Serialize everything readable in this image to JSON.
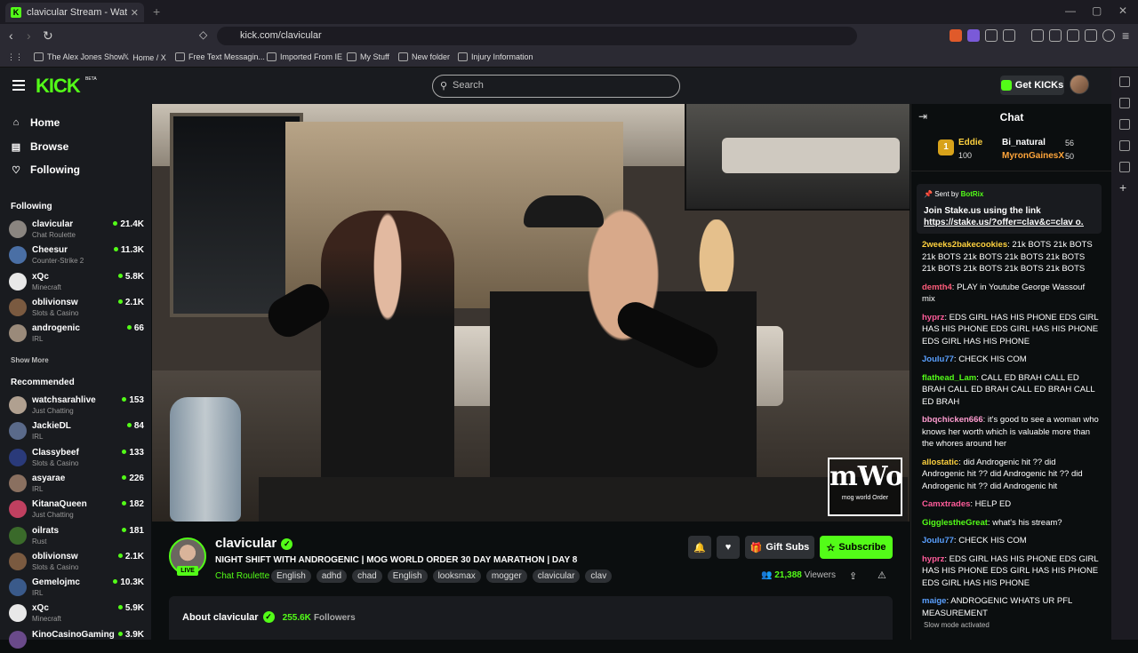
{
  "browser": {
    "tab_title": "clavicular Stream - Watch Live",
    "url": "kick.com/clavicular",
    "bookmarks": [
      "The Alex Jones Show",
      "Home / X",
      "Free Text Messagin...",
      "Imported From IE",
      "My Stuff",
      "New folder",
      "Injury Information"
    ]
  },
  "header": {
    "logo": "KICK",
    "beta": "BETA",
    "search_placeholder": "Search",
    "get_kicks": "Get KICKs"
  },
  "nav": [
    {
      "label": "Home",
      "icon": "home-icon"
    },
    {
      "label": "Browse",
      "icon": "browse-icon"
    },
    {
      "label": "Following",
      "icon": "heart-icon"
    }
  ],
  "following_title": "Following",
  "following": [
    {
      "name": "clavicular",
      "category": "Chat Roulette",
      "viewers": "21.4K",
      "color": "#8a8580"
    },
    {
      "name": "Cheesur",
      "category": "Counter-Strike 2",
      "viewers": "11.3K",
      "color": "#4a6fa5"
    },
    {
      "name": "xQc",
      "category": "Minecraft",
      "viewers": "5.8K",
      "color": "#e8e8e8"
    },
    {
      "name": "oblivionsw",
      "category": "Slots & Casino",
      "viewers": "2.1K",
      "color": "#7a5a40"
    },
    {
      "name": "androgenic",
      "category": "IRL",
      "viewers": "66",
      "color": "#9a8a7a"
    }
  ],
  "show_more": "Show More",
  "recommended_title": "Recommended",
  "recommended": [
    {
      "name": "watchsarahlive",
      "category": "Just Chatting",
      "viewers": "153",
      "color": "#b0a090"
    },
    {
      "name": "JackieDL",
      "category": "IRL",
      "viewers": "84",
      "color": "#5a6a8a"
    },
    {
      "name": "Classybeef",
      "category": "Slots & Casino",
      "viewers": "133",
      "color": "#2a3a7a"
    },
    {
      "name": "asyarae",
      "category": "IRL",
      "viewers": "226",
      "color": "#8a7060"
    },
    {
      "name": "KitanaQueen",
      "category": "Just Chatting",
      "viewers": "182",
      "color": "#c04060"
    },
    {
      "name": "oilrats",
      "category": "Rust",
      "viewers": "181",
      "color": "#3a6a2a"
    },
    {
      "name": "oblivionsw",
      "category": "Slots & Casino",
      "viewers": "2.1K",
      "color": "#7a5a40"
    },
    {
      "name": "Gemelojmc",
      "category": "IRL",
      "viewers": "10.3K",
      "color": "#3a5a8a"
    },
    {
      "name": "xQc",
      "category": "Minecraft",
      "viewers": "5.9K",
      "color": "#e8e8e8"
    },
    {
      "name": "KinoCasinoGaming",
      "category": "",
      "viewers": "3.9K",
      "color": "#6a4a8a"
    }
  ],
  "video": {
    "watermark_big": "mWo",
    "watermark_small": "mog world Order"
  },
  "stream": {
    "streamer": "clavicular",
    "live": "LIVE",
    "title": "NIGHT SHIFT WITH ANDROGENIC | MOG WORLD ORDER 30 DAY MARATHON | DAY 8",
    "category": "Chat Roulette",
    "tags": [
      "English",
      "adhd",
      "chad",
      "English",
      "looksmax",
      "mogger",
      "clavicular",
      "clav"
    ],
    "gift_subs": "Gift Subs",
    "subscribe": "Subscribe",
    "viewers": "21,388",
    "viewers_label": "Viewers",
    "about": "About clavicular",
    "followers": "255.6K",
    "followers_label": "Followers"
  },
  "chat": {
    "title": "Chat",
    "leaderboard": [
      {
        "rank": "1",
        "name": "Eddie",
        "value": "100"
      },
      {
        "name": "Bi_natural",
        "value": "56"
      },
      {
        "name": "MyronGainesX",
        "value": "50"
      }
    ],
    "pinned": {
      "sent_by": "Sent by",
      "bot": "BotRix",
      "message": "Join Stake.us using the link",
      "link": "https://stake.us/?offer=clav&c=clav o..."
    },
    "messages": [
      {
        "user": "2weeks2bakecookies",
        "color": "#ffd23f",
        "text": "21k BOTS 21k BOTS 21k BOTS 21k BOTS 21k BOTS 21k BOTS 21k BOTS 21k BOTS 21k BOTS 21k BOTS"
      },
      {
        "user": "demth4",
        "color": "#ff5c7a",
        "text": "PLAY in Youtube George Wassouf mix"
      },
      {
        "user": "hyprz",
        "color": "#ff5c9a",
        "text": "EDS GIRL HAS HIS PHONE EDS GIRL HAS HIS PHONE EDS GIRL HAS HIS PHONE EDS GIRL HAS HIS PHONE"
      },
      {
        "user": "Joulu77",
        "color": "#5aa0ff",
        "text": "CHECK HIS COM"
      },
      {
        "user": "flathead_Lam",
        "color": "#53fc18",
        "text": "CALL ED BRAH CALL ED BRAH CALL ED BRAH CALL ED BRAH CALL ED BRAH"
      },
      {
        "user": "bbqchicken666",
        "color": "#ff9cd0",
        "text": "it's good to see a woman who knows her worth which is valuable more than the whores around her"
      },
      {
        "user": "allostatic",
        "color": "#ffd23f",
        "text": "did Androgenic hit ?? did Androgenic hit ?? did Androgenic hit ?? did Androgenic hit ?? did Androgenic hit"
      },
      {
        "user": "Camxtrades",
        "color": "#ff5c9a",
        "text": "HELP ED"
      },
      {
        "user": "GigglestheGreat",
        "color": "#53fc18",
        "text": "what's his stream?"
      },
      {
        "user": "Joulu77",
        "color": "#5aa0ff",
        "text": "CHECK HIS COM"
      },
      {
        "user": "hyprz",
        "color": "#ff5c9a",
        "text": "EDS GIRL HAS HIS PHONE EDS GIRL HAS HIS PHONE EDS GIRL HAS HIS PHONE EDS GIRL HAS HIS PHONE"
      },
      {
        "user": "maige",
        "color": "#5aa0ff",
        "text": "ANDROGENIC WHATS UR PFL MEASUREMENT"
      }
    ],
    "slow_mode": "Slow mode activated"
  }
}
